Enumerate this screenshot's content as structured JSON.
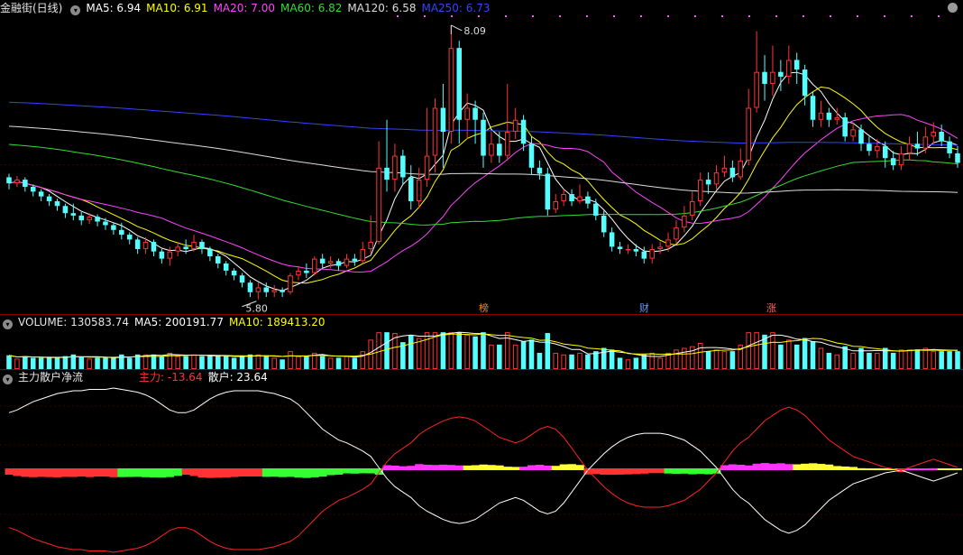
{
  "header": {
    "title": "金融街(日线)",
    "ma_labels": [
      {
        "text": "MA5: 6.94",
        "color": "#ffffff"
      },
      {
        "text": "MA10: 6.91",
        "color": "#ffff00"
      },
      {
        "text": "MA20: 7.00",
        "color": "#ff44ff"
      },
      {
        "text": "MA60: 6.82",
        "color": "#33dd33"
      },
      {
        "text": "MA120: 6.58",
        "color": "#dddddd"
      },
      {
        "text": "MA250: 6.73",
        "color": "#3344ff"
      }
    ]
  },
  "volume_header": {
    "volume": "VOLUME: 130583.74",
    "ma5": "MA5: 200191.77",
    "ma10": "MA10: 189413.20"
  },
  "flow_header": {
    "title": "主力散户净流",
    "main": "主力: -13.64",
    "retail": "散户: 23.64"
  },
  "annotations": {
    "high": "8.09",
    "low": "5.80",
    "tags": [
      "榜",
      "财",
      "涨"
    ]
  },
  "colors": {
    "up": "#ff3333",
    "down": "#55ffff",
    "ma5": "#ffffff",
    "ma10": "#ffff00",
    "ma20": "#ff44ff",
    "ma60": "#33dd33",
    "ma120": "#dddddd",
    "ma250": "#3344ff",
    "grid": "#8b0000",
    "retail_line": "#ffffff",
    "main_line": "#ff2222"
  },
  "chart_data": {
    "type": "candlestick",
    "price_range": [
      5.7,
      8.15
    ],
    "volume_range": [
      0,
      500000
    ],
    "flow_range": [
      -60,
      60
    ],
    "candles": [
      {
        "o": 6.82,
        "c": 6.77,
        "h": 6.85,
        "l": 6.72
      },
      {
        "o": 6.77,
        "c": 6.8,
        "h": 6.83,
        "l": 6.74
      },
      {
        "o": 6.8,
        "c": 6.74,
        "h": 6.82,
        "l": 6.7
      },
      {
        "o": 6.74,
        "c": 6.7,
        "h": 6.76,
        "l": 6.66
      },
      {
        "o": 6.7,
        "c": 6.66,
        "h": 6.72,
        "l": 6.62
      },
      {
        "o": 6.66,
        "c": 6.62,
        "h": 6.68,
        "l": 6.58
      },
      {
        "o": 6.62,
        "c": 6.58,
        "h": 6.64,
        "l": 6.54
      },
      {
        "o": 6.58,
        "c": 6.52,
        "h": 6.6,
        "l": 6.48
      },
      {
        "o": 6.52,
        "c": 6.5,
        "h": 6.6,
        "l": 6.46
      },
      {
        "o": 6.5,
        "c": 6.46,
        "h": 6.53,
        "l": 6.42
      },
      {
        "o": 6.46,
        "c": 6.49,
        "h": 6.52,
        "l": 6.43
      },
      {
        "o": 6.49,
        "c": 6.45,
        "h": 6.51,
        "l": 6.41
      },
      {
        "o": 6.45,
        "c": 6.42,
        "h": 6.48,
        "l": 6.38
      },
      {
        "o": 6.42,
        "c": 6.38,
        "h": 6.44,
        "l": 6.34
      },
      {
        "o": 6.38,
        "c": 6.34,
        "h": 6.44,
        "l": 6.3
      },
      {
        "o": 6.34,
        "c": 6.3,
        "h": 6.36,
        "l": 6.26
      },
      {
        "o": 6.3,
        "c": 6.22,
        "h": 6.32,
        "l": 6.18
      },
      {
        "o": 6.22,
        "c": 6.28,
        "h": 6.32,
        "l": 6.18
      },
      {
        "o": 6.28,
        "c": 6.2,
        "h": 6.3,
        "l": 6.16
      },
      {
        "o": 6.2,
        "c": 6.14,
        "h": 6.22,
        "l": 6.1
      },
      {
        "o": 6.14,
        "c": 6.2,
        "h": 6.24,
        "l": 6.08
      },
      {
        "o": 6.2,
        "c": 6.24,
        "h": 6.28,
        "l": 6.16
      },
      {
        "o": 6.24,
        "c": 6.22,
        "h": 6.3,
        "l": 6.18
      },
      {
        "o": 6.22,
        "c": 6.28,
        "h": 6.34,
        "l": 6.2
      },
      {
        "o": 6.28,
        "c": 6.22,
        "h": 6.3,
        "l": 6.18
      },
      {
        "o": 6.22,
        "c": 6.16,
        "h": 6.24,
        "l": 6.12
      },
      {
        "o": 6.16,
        "c": 6.1,
        "h": 6.18,
        "l": 6.06
      },
      {
        "o": 6.1,
        "c": 6.04,
        "h": 6.12,
        "l": 6.0
      },
      {
        "o": 6.04,
        "c": 6.0,
        "h": 6.06,
        "l": 5.96
      },
      {
        "o": 6.0,
        "c": 5.94,
        "h": 6.02,
        "l": 5.9
      },
      {
        "o": 5.94,
        "c": 5.86,
        "h": 5.96,
        "l": 5.82
      },
      {
        "o": 5.86,
        "c": 5.9,
        "h": 5.94,
        "l": 5.8
      },
      {
        "o": 5.9,
        "c": 5.86,
        "h": 5.94,
        "l": 5.82
      },
      {
        "o": 5.86,
        "c": 5.88,
        "h": 5.92,
        "l": 5.82
      },
      {
        "o": 5.88,
        "c": 5.86,
        "h": 5.9,
        "l": 5.82
      },
      {
        "o": 5.86,
        "c": 6.0,
        "h": 6.02,
        "l": 5.84
      },
      {
        "o": 6.0,
        "c": 6.04,
        "h": 6.08,
        "l": 5.96
      },
      {
        "o": 6.04,
        "c": 6.02,
        "h": 6.1,
        "l": 5.98
      },
      {
        "o": 6.02,
        "c": 6.14,
        "h": 6.16,
        "l": 6.0
      },
      {
        "o": 6.14,
        "c": 6.1,
        "h": 6.18,
        "l": 6.06
      },
      {
        "o": 6.1,
        "c": 6.12,
        "h": 6.16,
        "l": 6.06
      },
      {
        "o": 6.12,
        "c": 6.08,
        "h": 6.14,
        "l": 6.04
      },
      {
        "o": 6.08,
        "c": 6.14,
        "h": 6.18,
        "l": 6.06
      },
      {
        "o": 6.14,
        "c": 6.12,
        "h": 6.18,
        "l": 6.08
      },
      {
        "o": 6.12,
        "c": 6.22,
        "h": 6.28,
        "l": 6.1
      },
      {
        "o": 6.22,
        "c": 6.28,
        "h": 6.5,
        "l": 6.18
      },
      {
        "o": 6.28,
        "c": 6.9,
        "h": 7.12,
        "l": 6.26
      },
      {
        "o": 6.9,
        "c": 6.8,
        "h": 7.3,
        "l": 6.7
      },
      {
        "o": 6.8,
        "c": 7.0,
        "h": 7.1,
        "l": 6.7
      },
      {
        "o": 7.0,
        "c": 6.82,
        "h": 7.05,
        "l": 6.76
      },
      {
        "o": 6.82,
        "c": 6.62,
        "h": 6.92,
        "l": 6.55
      },
      {
        "o": 6.62,
        "c": 6.8,
        "h": 6.9,
        "l": 6.56
      },
      {
        "o": 6.8,
        "c": 7.0,
        "h": 7.4,
        "l": 6.74
      },
      {
        "o": 7.0,
        "c": 7.4,
        "h": 7.48,
        "l": 6.86
      },
      {
        "o": 7.4,
        "c": 7.2,
        "h": 7.6,
        "l": 6.9
      },
      {
        "o": 7.2,
        "c": 7.9,
        "h": 8.09,
        "l": 7.1
      },
      {
        "o": 7.9,
        "c": 7.3,
        "h": 7.96,
        "l": 7.1
      },
      {
        "o": 7.3,
        "c": 7.4,
        "h": 7.52,
        "l": 7.14
      },
      {
        "o": 7.4,
        "c": 7.3,
        "h": 7.46,
        "l": 7.1
      },
      {
        "o": 7.3,
        "c": 7.0,
        "h": 7.36,
        "l": 6.9
      },
      {
        "o": 7.0,
        "c": 7.1,
        "h": 7.2,
        "l": 6.94
      },
      {
        "o": 7.1,
        "c": 7.0,
        "h": 7.2,
        "l": 6.94
      },
      {
        "o": 7.0,
        "c": 7.2,
        "h": 7.6,
        "l": 6.96
      },
      {
        "o": 7.2,
        "c": 7.3,
        "h": 7.4,
        "l": 7.14
      },
      {
        "o": 7.3,
        "c": 7.1,
        "h": 7.34,
        "l": 7.04
      },
      {
        "o": 7.1,
        "c": 6.9,
        "h": 7.16,
        "l": 6.84
      },
      {
        "o": 6.9,
        "c": 6.85,
        "h": 6.96,
        "l": 6.8
      },
      {
        "o": 6.85,
        "c": 6.55,
        "h": 6.9,
        "l": 6.5
      },
      {
        "o": 6.55,
        "c": 6.62,
        "h": 6.68,
        "l": 6.52
      },
      {
        "o": 6.62,
        "c": 6.68,
        "h": 6.72,
        "l": 6.58
      },
      {
        "o": 6.68,
        "c": 6.62,
        "h": 6.72,
        "l": 6.58
      },
      {
        "o": 6.62,
        "c": 6.66,
        "h": 6.76,
        "l": 6.6
      },
      {
        "o": 6.66,
        "c": 6.6,
        "h": 6.7,
        "l": 6.56
      },
      {
        "o": 6.6,
        "c": 6.5,
        "h": 6.64,
        "l": 6.46
      },
      {
        "o": 6.5,
        "c": 6.36,
        "h": 6.54,
        "l": 6.32
      },
      {
        "o": 6.36,
        "c": 6.24,
        "h": 6.4,
        "l": 6.2
      },
      {
        "o": 6.24,
        "c": 6.22,
        "h": 6.28,
        "l": 6.18
      },
      {
        "o": 6.22,
        "c": 6.22,
        "h": 6.26,
        "l": 6.18
      },
      {
        "o": 6.22,
        "c": 6.2,
        "h": 6.26,
        "l": 6.16
      },
      {
        "o": 6.2,
        "c": 6.14,
        "h": 6.24,
        "l": 6.1
      },
      {
        "o": 6.14,
        "c": 6.22,
        "h": 6.26,
        "l": 6.1
      },
      {
        "o": 6.22,
        "c": 6.24,
        "h": 6.28,
        "l": 6.18
      },
      {
        "o": 6.24,
        "c": 6.3,
        "h": 6.36,
        "l": 6.2
      },
      {
        "o": 6.3,
        "c": 6.4,
        "h": 6.46,
        "l": 6.26
      },
      {
        "o": 6.4,
        "c": 6.5,
        "h": 6.58,
        "l": 6.36
      },
      {
        "o": 6.5,
        "c": 6.62,
        "h": 6.7,
        "l": 6.46
      },
      {
        "o": 6.62,
        "c": 6.8,
        "h": 6.86,
        "l": 6.58
      },
      {
        "o": 6.8,
        "c": 6.76,
        "h": 6.86,
        "l": 6.68
      },
      {
        "o": 6.76,
        "c": 6.86,
        "h": 6.92,
        "l": 6.72
      },
      {
        "o": 6.86,
        "c": 6.9,
        "h": 7.0,
        "l": 6.82
      },
      {
        "o": 6.9,
        "c": 6.82,
        "h": 6.96,
        "l": 6.78
      },
      {
        "o": 6.82,
        "c": 6.96,
        "h": 7.06,
        "l": 6.8
      },
      {
        "o": 6.96,
        "c": 7.4,
        "h": 7.56,
        "l": 6.92
      },
      {
        "o": 7.4,
        "c": 7.7,
        "h": 8.04,
        "l": 7.36
      },
      {
        "o": 7.7,
        "c": 7.6,
        "h": 7.84,
        "l": 7.46
      },
      {
        "o": 7.6,
        "c": 7.7,
        "h": 7.92,
        "l": 7.5
      },
      {
        "o": 7.7,
        "c": 7.66,
        "h": 7.8,
        "l": 7.54
      },
      {
        "o": 7.66,
        "c": 7.8,
        "h": 7.92,
        "l": 7.6
      },
      {
        "o": 7.8,
        "c": 7.72,
        "h": 7.86,
        "l": 7.6
      },
      {
        "o": 7.72,
        "c": 7.5,
        "h": 7.76,
        "l": 7.42
      },
      {
        "o": 7.5,
        "c": 7.3,
        "h": 7.54,
        "l": 7.24
      },
      {
        "o": 7.3,
        "c": 7.36,
        "h": 7.46,
        "l": 7.24
      },
      {
        "o": 7.36,
        "c": 7.3,
        "h": 7.4,
        "l": 7.24
      },
      {
        "o": 7.3,
        "c": 7.32,
        "h": 7.4,
        "l": 7.26
      },
      {
        "o": 7.32,
        "c": 7.16,
        "h": 7.36,
        "l": 7.12
      },
      {
        "o": 7.16,
        "c": 7.22,
        "h": 7.28,
        "l": 7.12
      },
      {
        "o": 7.22,
        "c": 7.1,
        "h": 7.26,
        "l": 7.04
      },
      {
        "o": 7.1,
        "c": 7.04,
        "h": 7.16,
        "l": 7.0
      },
      {
        "o": 7.04,
        "c": 7.08,
        "h": 7.14,
        "l": 6.98
      },
      {
        "o": 7.08,
        "c": 6.98,
        "h": 7.12,
        "l": 6.9
      },
      {
        "o": 6.98,
        "c": 6.92,
        "h": 7.04,
        "l": 6.88
      },
      {
        "o": 6.92,
        "c": 7.02,
        "h": 7.08,
        "l": 6.88
      },
      {
        "o": 7.02,
        "c": 7.1,
        "h": 7.16,
        "l": 6.96
      },
      {
        "o": 7.1,
        "c": 7.06,
        "h": 7.2,
        "l": 7.0
      },
      {
        "o": 7.06,
        "c": 7.16,
        "h": 7.24,
        "l": 7.02
      },
      {
        "o": 7.16,
        "c": 7.2,
        "h": 7.28,
        "l": 7.1
      },
      {
        "o": 7.2,
        "c": 7.12,
        "h": 7.26,
        "l": 7.08
      },
      {
        "o": 7.12,
        "c": 7.02,
        "h": 7.16,
        "l": 6.98
      },
      {
        "o": 7.02,
        "c": 6.94,
        "h": 7.08,
        "l": 6.9
      }
    ],
    "retail_flow": [
      42,
      44,
      47,
      50,
      52,
      54,
      56,
      57,
      58,
      58,
      59,
      59,
      59,
      60,
      59,
      58,
      57,
      55,
      52,
      48,
      44,
      42,
      42,
      44,
      48,
      52,
      55,
      57,
      58,
      58,
      58,
      58,
      57,
      56,
      54,
      52,
      48,
      42,
      36,
      30,
      26,
      22,
      20,
      17,
      14,
      10,
      2,
      -6,
      -12,
      -16,
      -20,
      -26,
      -30,
      -33,
      -36,
      -38,
      -39,
      -38,
      -36,
      -32,
      -28,
      -24,
      -22,
      -20,
      -22,
      -26,
      -30,
      -32,
      -30,
      -24,
      -16,
      -8,
      0,
      6,
      12,
      17,
      21,
      24,
      26,
      27,
      27,
      27,
      26,
      24,
      22,
      18,
      14,
      8,
      2,
      -6,
      -14,
      -20,
      -24,
      -30,
      -36,
      -40,
      -44,
      -46,
      -44,
      -40,
      -34,
      -28,
      -22,
      -18,
      -14,
      -10,
      -8,
      -6,
      -4,
      -2,
      -1,
      0,
      -2,
      -4,
      -6,
      -8,
      -6,
      -4,
      -2
    ],
    "main_flow": [
      -42,
      -44,
      -47,
      -50,
      -52,
      -54,
      -56,
      -57,
      -58,
      -58,
      -59,
      -59,
      -59,
      -60,
      -59,
      -58,
      -57,
      -55,
      -52,
      -48,
      -44,
      -42,
      -42,
      -44,
      -48,
      -52,
      -55,
      -57,
      -58,
      -58,
      -58,
      -58,
      -57,
      -56,
      -54,
      -52,
      -48,
      -42,
      -36,
      -30,
      -26,
      -22,
      -20,
      -17,
      -14,
      -10,
      -2,
      6,
      12,
      16,
      20,
      26,
      30,
      33,
      36,
      38,
      39,
      38,
      36,
      32,
      28,
      24,
      22,
      20,
      22,
      26,
      30,
      32,
      30,
      24,
      16,
      8,
      0,
      -6,
      -12,
      -17,
      -21,
      -24,
      -26,
      -27,
      -27,
      -27,
      -26,
      -24,
      -22,
      -18,
      -14,
      -8,
      -2,
      6,
      14,
      20,
      24,
      30,
      36,
      40,
      44,
      46,
      44,
      40,
      34,
      28,
      22,
      18,
      14,
      10,
      8,
      6,
      4,
      2,
      1,
      0,
      2,
      4,
      6,
      8,
      6,
      4,
      2
    ]
  }
}
